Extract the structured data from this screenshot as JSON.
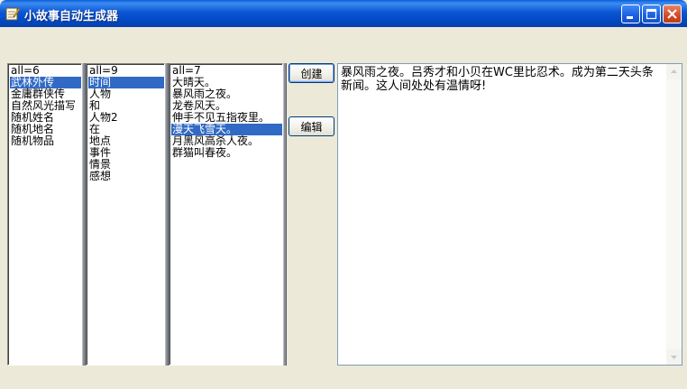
{
  "window": {
    "title": "小故事自动生成器",
    "icon": "pencil-note-icon",
    "controls": [
      "minimize-icon",
      "maximize-icon",
      "close-icon"
    ]
  },
  "lists": {
    "categories": {
      "header": "all=6",
      "items": [
        "武林外传",
        "金庸群侠传",
        "自然风光描写",
        "随机姓名",
        "随机地名",
        "随机物品"
      ],
      "selected": "武林外传"
    },
    "elements": {
      "header": "all=9",
      "items": [
        "时间",
        "人物",
        "和",
        "人物2",
        "在",
        "地点",
        "事件",
        "情景",
        "感想"
      ],
      "selected": "时间"
    },
    "values": {
      "header": "all=7",
      "items": [
        "大晴天。",
        "暴风雨之夜。",
        "龙卷风天。",
        "伸手不见五指夜里。",
        "漫天飞雪天。",
        "月黑风高杀人夜。",
        "群猫叫春夜。"
      ],
      "selected": "漫天飞雪天。"
    }
  },
  "buttons": {
    "create": "创建",
    "edit": "编辑"
  },
  "output": {
    "text": "暴风雨之夜。吕秀才和小贝在WC里比忍术。成为第二天头条新闻。这人间处处有温情呀!"
  },
  "colors": {
    "titlebar": "#0a5fd8",
    "selection": "#316ac5",
    "face": "#ece9d8"
  }
}
